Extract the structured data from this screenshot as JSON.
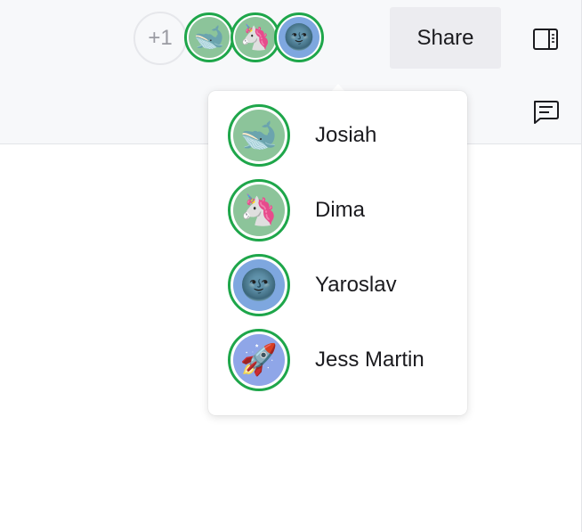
{
  "header": {
    "share_label": "Share",
    "more_count": "+1"
  },
  "collaborators": [
    {
      "name": "Josiah",
      "emoji": "🐋",
      "bg": "#8cc49a"
    },
    {
      "name": "Dima",
      "emoji": "🦄",
      "bg": "#8cc49a"
    },
    {
      "name": "Yaroslav",
      "emoji": "🌚",
      "bg": "#7ea7df"
    },
    {
      "name": "Jess Martin",
      "emoji": "🚀",
      "bg": "#8fa6e8"
    }
  ],
  "colors": {
    "online_ring": "#1ea64a",
    "header_bg": "#f7f8fa",
    "share_bg": "#ececf0"
  },
  "icons": {
    "panel_toggle": "sidebar-panel-icon",
    "comments": "comment-icon"
  }
}
